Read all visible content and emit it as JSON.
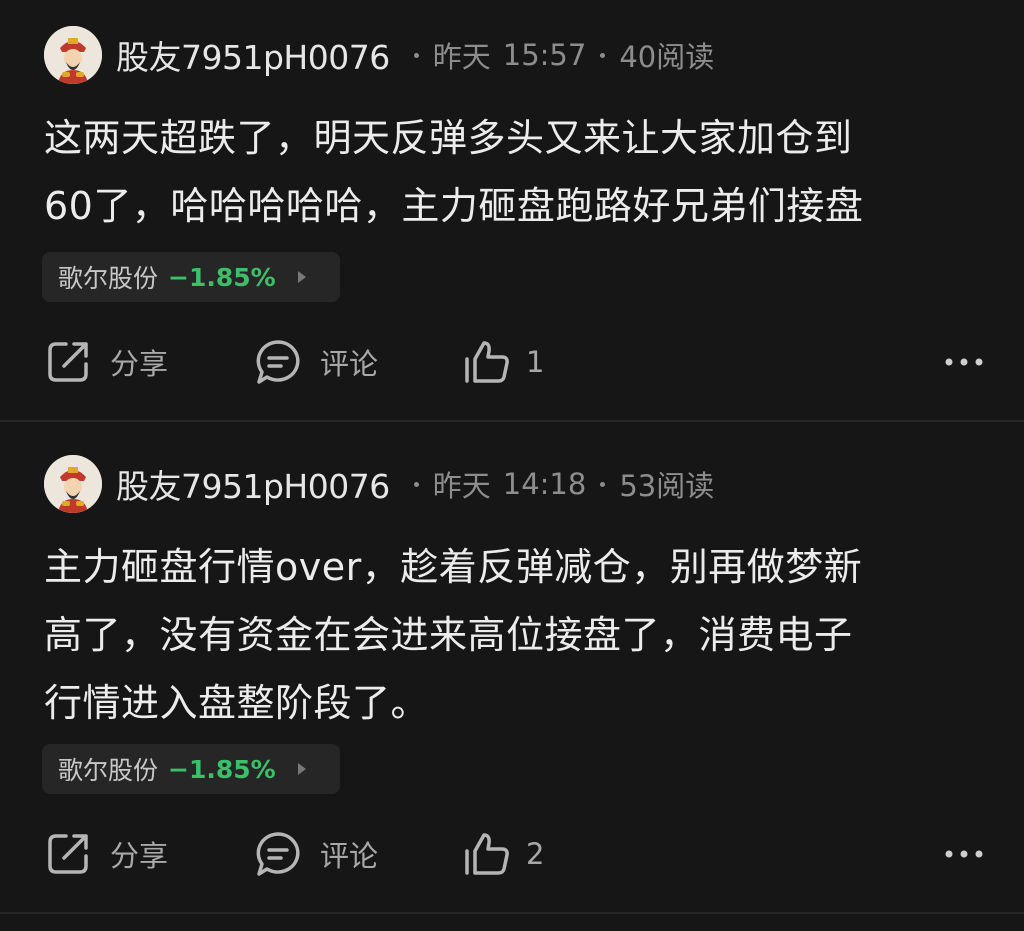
{
  "posts": [
    {
      "author": "股友7951pH0076",
      "date": "昨天",
      "time": "15:57",
      "reads": "40阅读",
      "text_lines": [
        "这两天超跌了，明天反弹多头又来让大家加仓到",
        "60了，哈哈哈哈哈，主力砸盘跑路好兄弟们接盘"
      ],
      "stock": {
        "name": "歌尔股份",
        "change": "−1.85%"
      },
      "actions": {
        "share": "分享",
        "comment": "评论",
        "like_count": "1"
      }
    },
    {
      "author": "股友7951pH0076",
      "date": "昨天",
      "time": "14:18",
      "reads": "53阅读",
      "text_lines": [
        "主力砸盘行情over，趁着反弹减仓，别再做梦新",
        "高了，没有资金在会进来高位接盘了，消费电子",
        "行情进入盘整阶段了。"
      ],
      "stock": {
        "name": "歌尔股份",
        "change": "−1.85%"
      },
      "actions": {
        "share": "分享",
        "comment": "评论",
        "like_count": "2"
      }
    }
  ],
  "colors": {
    "background": "#161616",
    "tag_background": "#262626",
    "change_down": "#3bbf69",
    "meta": "#8d8d8d"
  },
  "icons": [
    "avatar-god-of-wealth",
    "share-icon",
    "comment-icon",
    "thumbs-up-icon",
    "more-icon"
  ]
}
